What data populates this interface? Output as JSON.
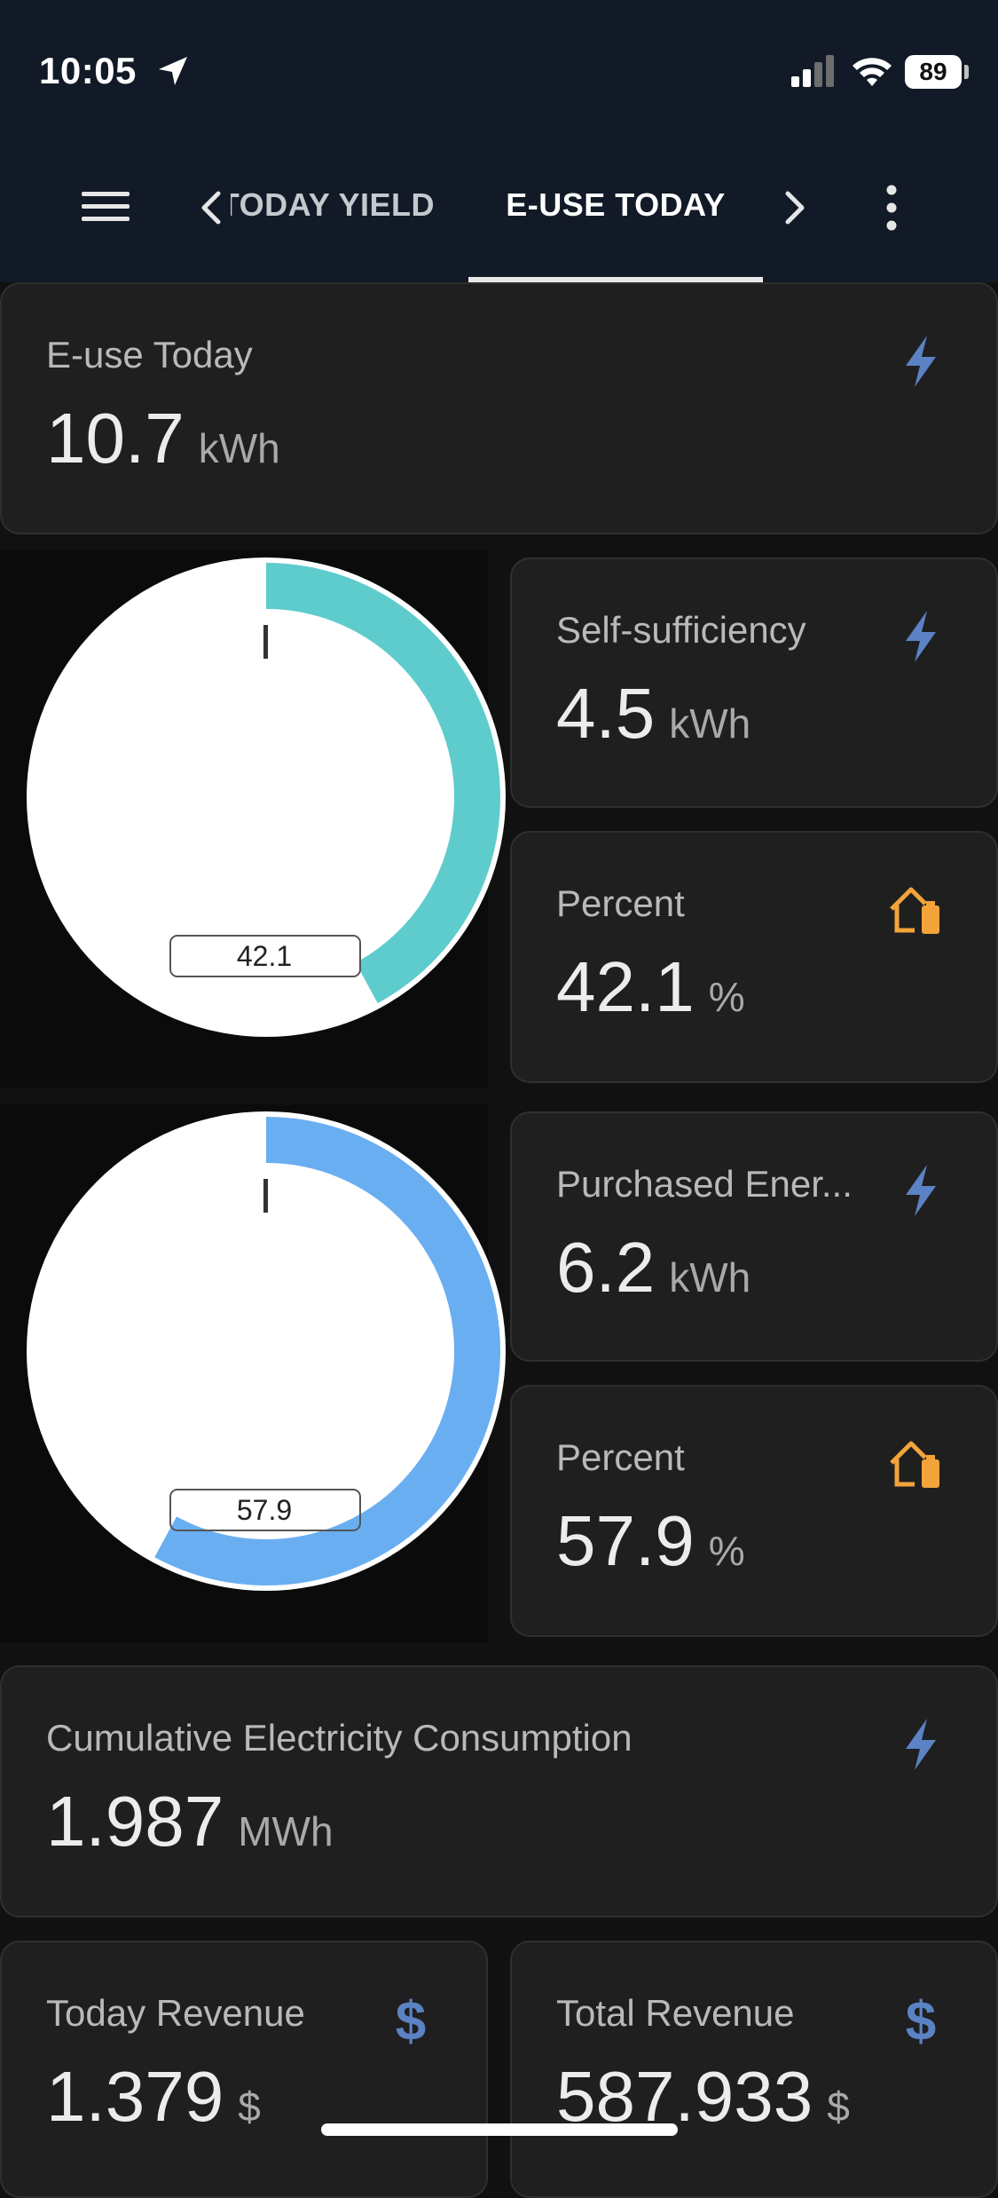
{
  "status": {
    "time": "10:05",
    "battery": "89"
  },
  "toolbar": {
    "prev_tab": "TODAY YIELD",
    "active_tab": "E-USE TODAY"
  },
  "cards": {
    "euse": {
      "label": "E-use Today",
      "value": "10.7",
      "unit": "kWh",
      "icon": "bolt-icon"
    },
    "self": {
      "label": "Self-sufficiency",
      "value": "4.5",
      "unit": "kWh",
      "icon": "bolt-icon"
    },
    "self_pct": {
      "label": "Percent",
      "value": "42.1",
      "unit": "%",
      "icon": "home-battery-icon"
    },
    "purchased": {
      "label": "Purchased Ener...",
      "value": "6.2",
      "unit": "kWh",
      "icon": "bolt-icon"
    },
    "purchased_pct": {
      "label": "Percent",
      "value": "57.9",
      "unit": "%",
      "icon": "home-battery-icon"
    },
    "cumulative": {
      "label": "Cumulative Electricity Consumption",
      "value": "1.987",
      "unit": "MWh",
      "icon": "bolt-icon"
    },
    "today_rev": {
      "label": "Today Revenue",
      "value": "1.379",
      "unit": "$",
      "icon": "dollar-icon"
    },
    "total_rev": {
      "label": "Total Revenue",
      "value": "587.933",
      "unit": "$",
      "icon": "dollar-icon"
    }
  },
  "gauges": [
    {
      "label": "42.1",
      "percent": 42.1,
      "color": "#5ecccc"
    },
    {
      "label": "57.9",
      "percent": 57.9,
      "color": "#6aaef2"
    }
  ],
  "colors": {
    "bolt": "#5b82c4",
    "home_battery": "#f2a43a",
    "dollar": "#5b82c4"
  }
}
